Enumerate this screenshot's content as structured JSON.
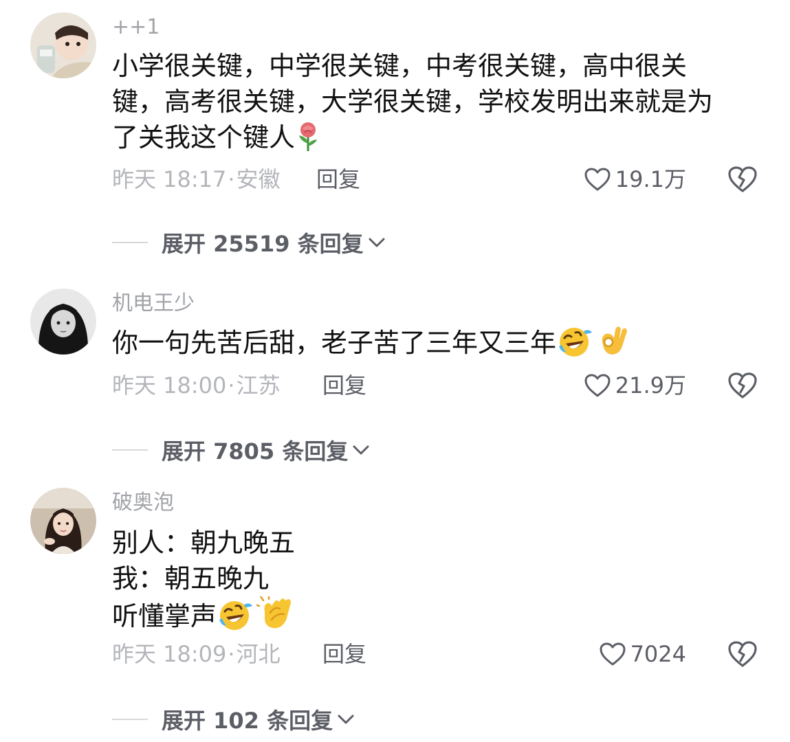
{
  "comments": [
    {
      "username": "++1",
      "content_lines": [
        "小学很关键，中学很关键，中考很关键，高中很关",
        "键，高考很关键，大学很关键，学校发明出来就是为",
        "了关我这个键人"
      ],
      "emojis": [
        "rose"
      ],
      "time": "昨天 18:17",
      "location": "安徽",
      "reply_label": "回复",
      "likes": "19.1万",
      "expand_label": "展开 25519 条回复"
    },
    {
      "username": "机电王少",
      "content_lines": [
        "你一句先苦后甜，老子苦了三年又三年"
      ],
      "emojis": [
        "rolling-on-floor-laughing",
        "ok-hand"
      ],
      "time": "昨天 18:00",
      "location": "江苏",
      "reply_label": "回复",
      "likes": "21.9万",
      "expand_label": "展开 7805 条回复"
    },
    {
      "username": "破奥泡",
      "content_lines": [
        "别人：朝九晚五",
        "我：朝五晚九",
        "听懂掌声"
      ],
      "emojis": [
        "rolling-on-floor-laughing",
        "clapping-hands"
      ],
      "time": "昨天 18:09",
      "location": "河北",
      "reply_label": "回复",
      "likes": "7024",
      "expand_label": "展开 102 条回复"
    }
  ],
  "meta_separator": "·",
  "colors": {
    "username": "#a1a3a8",
    "content": "#111111",
    "meta": "#b3b5ba",
    "action": "#5c5e66"
  }
}
